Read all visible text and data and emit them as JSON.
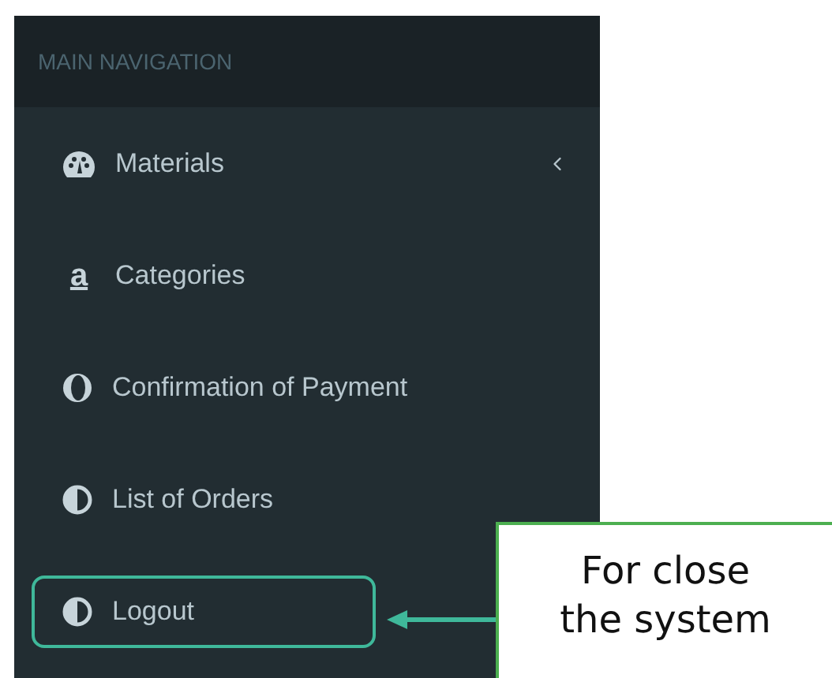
{
  "sidebar": {
    "header": "MAIN NAVIGATION",
    "items": [
      {
        "label": "Materials",
        "kind": "gauge",
        "submenu": true,
        "outlined": false
      },
      {
        "label": "Categories",
        "kind": "letter",
        "glyph": "a",
        "submenu": false,
        "outlined": false
      },
      {
        "label": "Confirmation of Payment",
        "kind": "ring",
        "submenu": false,
        "outlined": false
      },
      {
        "label": "List of Orders",
        "kind": "half",
        "submenu": false,
        "outlined": false
      },
      {
        "label": "Logout",
        "kind": "half",
        "submenu": false,
        "outlined": true
      }
    ]
  },
  "callout": {
    "text": "For close the system"
  }
}
